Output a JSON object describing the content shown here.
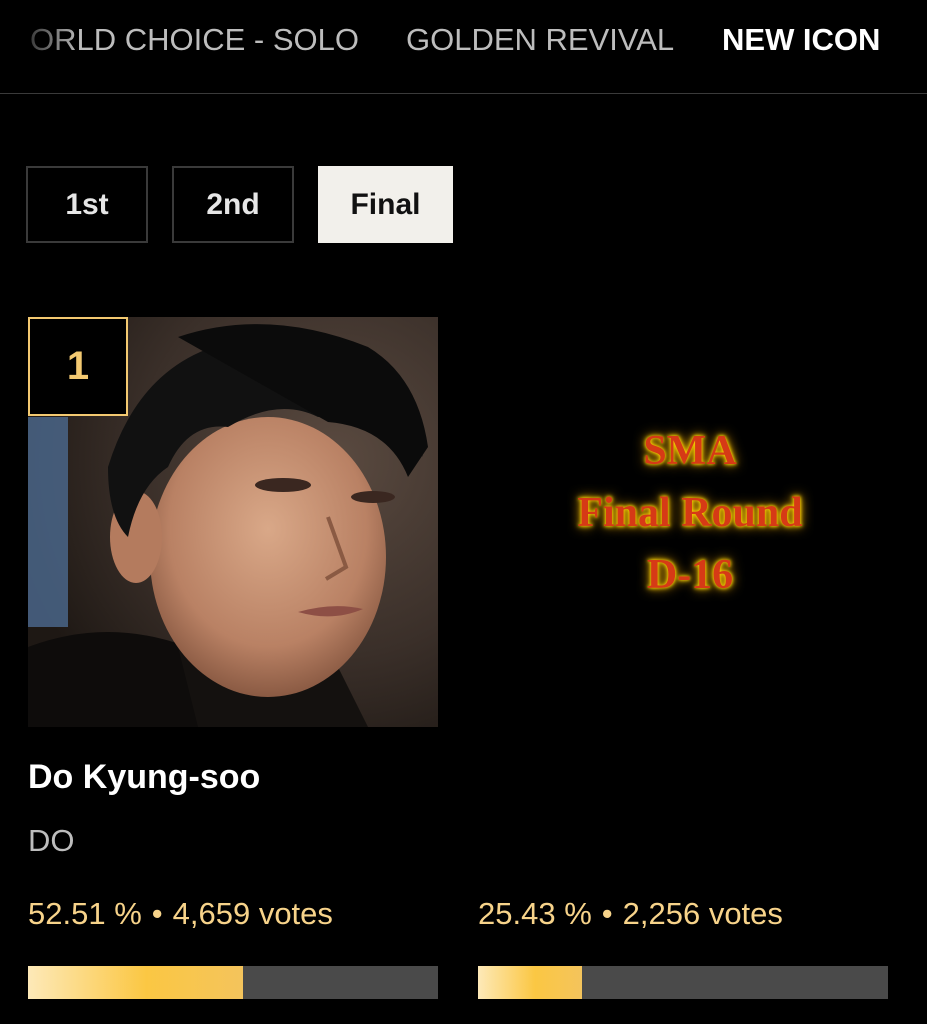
{
  "nav": {
    "tabs": [
      {
        "label": "ORLD CHOICE - SOLO",
        "active": false
      },
      {
        "label": "GOLDEN REVIVAL",
        "active": false
      },
      {
        "label": "NEW ICON",
        "active": true
      }
    ]
  },
  "rounds": {
    "buttons": [
      "1st",
      "2nd",
      "Final"
    ],
    "selected": "Final"
  },
  "candidate": {
    "rank": "1",
    "name": "Do Kyung-soo",
    "group": "DO"
  },
  "announcement": {
    "line1": "SMA",
    "line2": "Final Round",
    "line3": "D-16"
  },
  "results": [
    {
      "percent": "52.51 %",
      "separator": "•",
      "votes": "4,659 votes",
      "fraction": 0.5251
    },
    {
      "percent": "25.43 %",
      "separator": "•",
      "votes": "2,256 votes",
      "fraction": 0.2543
    }
  ],
  "colors": {
    "accent_gold": "#f3c971",
    "vote_text": "#f7d38a",
    "bar_track": "#4a4a4a",
    "announce_red": "#d63a16",
    "announce_glow": "#ffd400"
  }
}
